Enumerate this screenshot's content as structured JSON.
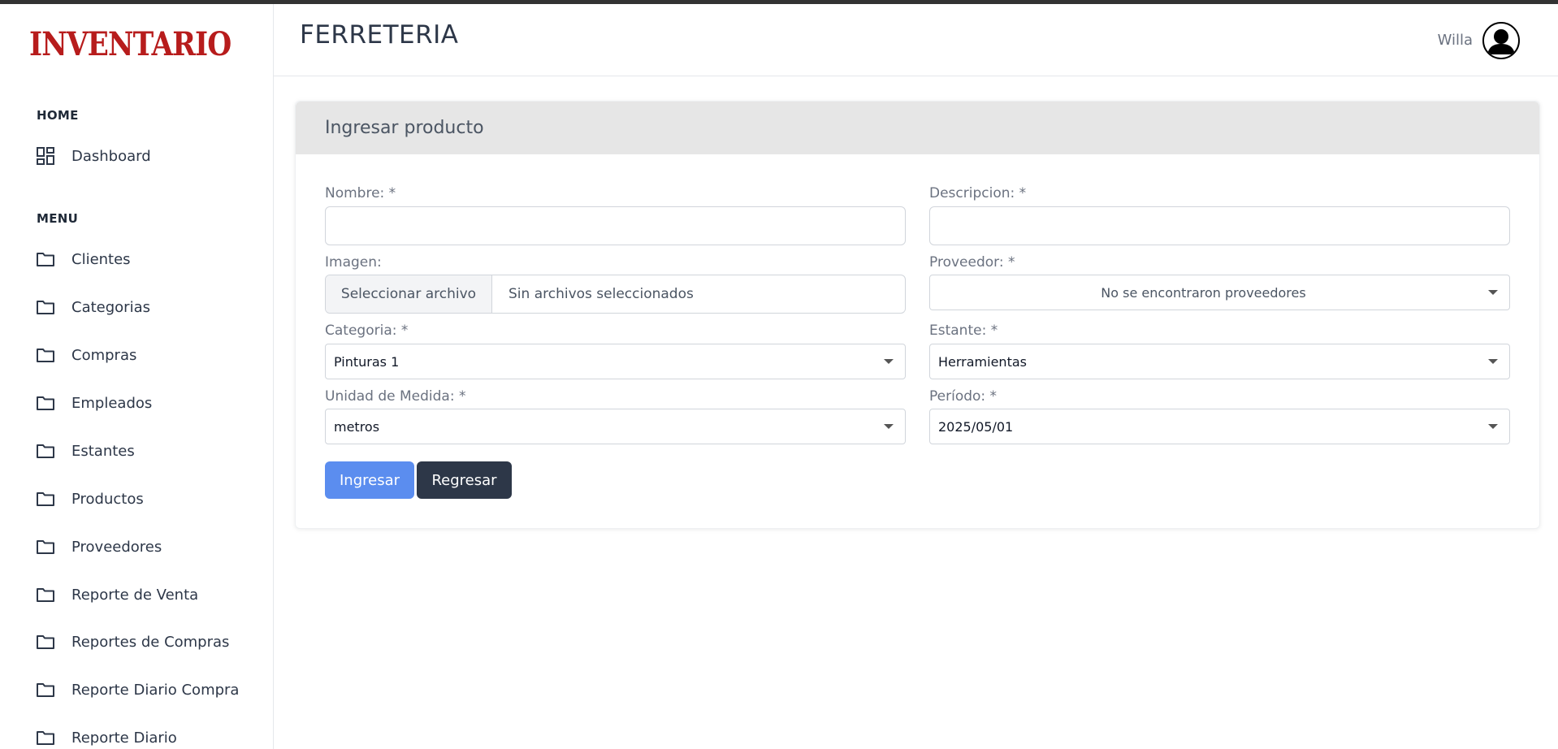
{
  "brand": {
    "logo_text": "INVENTARIO"
  },
  "header": {
    "title": "FERRETERIA",
    "user_name": "Willa"
  },
  "sidebar": {
    "home_label": "HOME",
    "home_items": [
      {
        "label": "Dashboard",
        "icon": "dashboard-icon"
      }
    ],
    "menu_label": "MENU",
    "menu_items": [
      {
        "label": "Clientes",
        "icon": "folder-icon"
      },
      {
        "label": "Categorias",
        "icon": "folder-icon"
      },
      {
        "label": "Compras",
        "icon": "folder-icon"
      },
      {
        "label": "Empleados",
        "icon": "folder-icon"
      },
      {
        "label": "Estantes",
        "icon": "folder-icon"
      },
      {
        "label": "Productos",
        "icon": "folder-icon"
      },
      {
        "label": "Proveedores",
        "icon": "folder-icon"
      },
      {
        "label": "Reporte de Venta",
        "icon": "folder-icon"
      },
      {
        "label": "Reportes de Compras",
        "icon": "folder-icon"
      },
      {
        "label": "Reporte Diario Compra",
        "icon": "folder-icon"
      },
      {
        "label": "Reporte Diario",
        "icon": "folder-icon"
      }
    ]
  },
  "form": {
    "title": "Ingresar producto",
    "nombre": {
      "label": "Nombre: *",
      "value": ""
    },
    "descripcion": {
      "label": "Descripcion: *",
      "value": ""
    },
    "imagen": {
      "label": "Imagen:",
      "button_label": "Seleccionar archivo",
      "status": "Sin archivos seleccionados"
    },
    "proveedor": {
      "label": "Proveedor: *",
      "selected": "No se encontraron proveedores"
    },
    "categoria": {
      "label": "Categoria: *",
      "selected": "Pinturas 1"
    },
    "estante": {
      "label": "Estante: *",
      "selected": "Herramientas"
    },
    "unidad": {
      "label": "Unidad de Medida: *",
      "selected": "metros"
    },
    "periodo": {
      "label": "Período: *",
      "selected": "2025/05/01"
    },
    "submit_label": "Ingresar",
    "back_label": "Regresar"
  },
  "colors": {
    "brand": "#b71c1c",
    "primary": "#5b8def",
    "dark": "#2d3748",
    "card_header": "#e6e6e6"
  }
}
